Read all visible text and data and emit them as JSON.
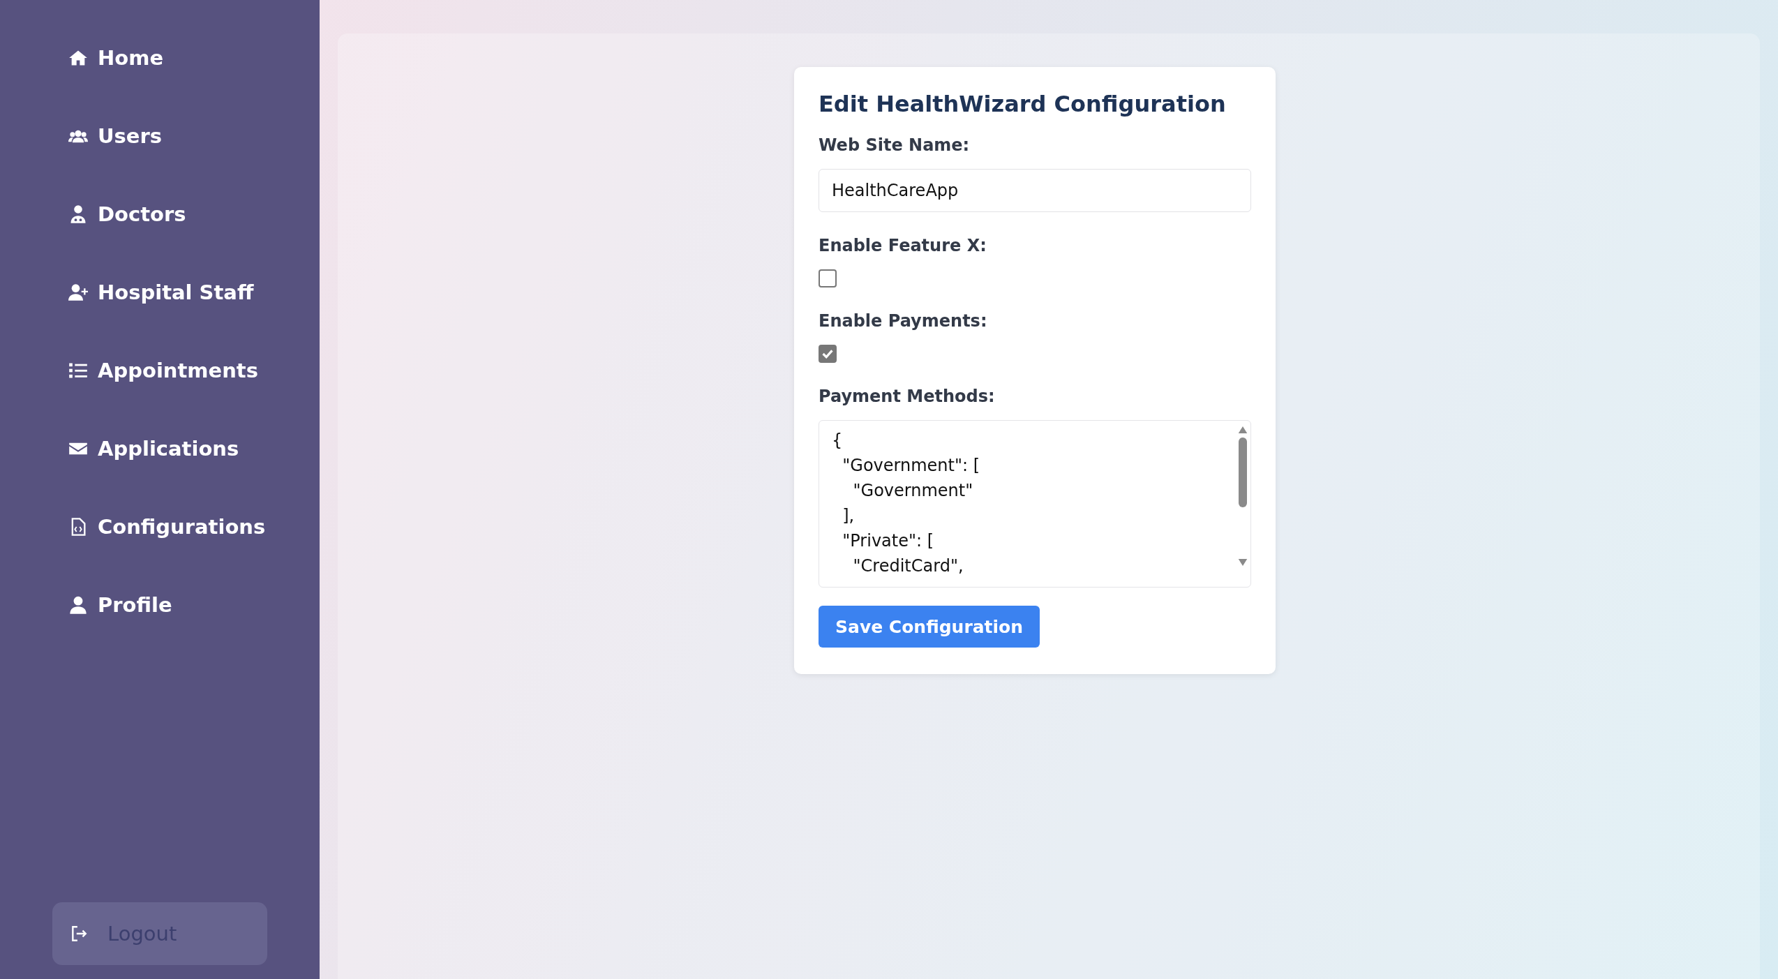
{
  "sidebar": {
    "items": [
      {
        "label": "Home"
      },
      {
        "label": "Users"
      },
      {
        "label": "Doctors"
      },
      {
        "label": "Hospital Staff"
      },
      {
        "label": "Appointments"
      },
      {
        "label": "Applications"
      },
      {
        "label": "Configurations"
      },
      {
        "label": "Profile"
      }
    ],
    "logout": "Logout"
  },
  "form": {
    "title": "Edit HealthWizard Configuration",
    "fields": [
      {
        "kind": "text",
        "label": "Web Site Name:",
        "value": "HealthCareApp"
      },
      {
        "kind": "checkbox",
        "label": "Enable Feature X:",
        "checked": false
      },
      {
        "kind": "checkbox",
        "label": "Enable Payments:",
        "checked": true
      },
      {
        "kind": "textarea",
        "label": "Payment Methods:",
        "lines": [
          "{",
          "  \"Government\": [",
          "    \"Government\"",
          "  ],",
          "  \"Private\": [",
          "    \"CreditCard\","
        ]
      }
    ],
    "save_button": "Save Configuration"
  }
}
